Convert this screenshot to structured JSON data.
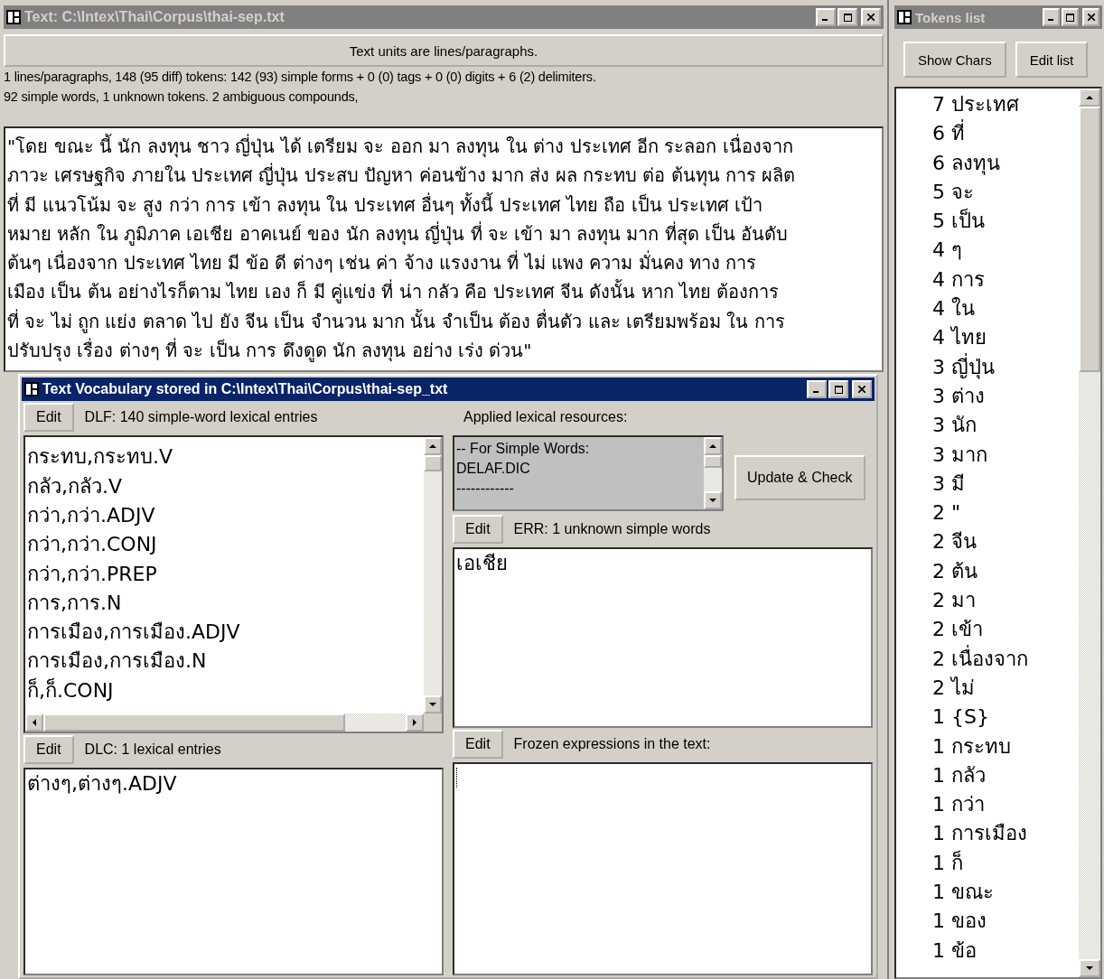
{
  "text_window": {
    "title": "Text: C:\\Intex\\Thai\\Corpus\\thai-sep.txt",
    "active": false,
    "units_button": "Text units are lines/paragraphs.",
    "stats": [
      "1 lines/paragraphs, 148 (95 diff) tokens: 142 (93) simple forms + 0 (0) tags + 0 (0) digits + 6 (2) delimiters.",
      "92 simple words, 1 unknown tokens. 2 ambiguous compounds,"
    ],
    "text_lines": [
      "\"โดย ขณะ นี้ นัก ลงทุน ชาว ญี่ปุ่น ได้ เตรียม จะ ออก มา ลงทุน ใน ต่าง ประเทศ อีก ระลอก เนื่องจาก",
      "ภาวะ เศรษฐกิจ ภายใน ประเทศ ญี่ปุ่น ประสบ ปัญหา ค่อนข้าง มาก ส่ง ผล กระทบ ต่อ ต้นทุน การ ผลิต",
      "ที่ มี แนวโน้ม จะ สูง กว่า การ เข้า ลงทุน ใน ประเทศ อื่นๆ ทั้งนี้ ประเทศ ไทย ถือ เป็น ประเทศ เป้า",
      "หมาย หลัก ใน ภูมิภาค เอเชีย อาคเนย์ ของ นัก ลงทุน ญี่ปุ่น ที่ จะ เข้า มา ลงทุน มาก ที่สุด เป็น อันดับ",
      "ต้นๆ เนื่องจาก ประเทศ ไทย มี ข้อ ดี ต่างๆ เช่น ค่า จ้าง แรงงาน ที่ ไม่ แพง ความ มั่นคง ทาง การ",
      "เมือง เป็น ต้น อย่างไรก็ตาม ไทย เอง ก็ มี คู่แข่ง ที่ น่า กลัว คือ ประเทศ จีน ดังนั้น หาก ไทย ต้องการ",
      "ที่ จะ ไม่ ถูก แย่ง ตลาด ไป ยัง จีน เป็น จำนวน มาก นั้น จำเป็น ต้อง ตื่นตัว และ เตรียมพร้อม ใน การ",
      "ปรับปรุง เรื่อง ต่างๆ ที่ จะ เป็น การ ดึงดูด นัก ลงทุน อย่าง เร่ง ด่วน\""
    ]
  },
  "vocabulary_window": {
    "title": "Text Vocabulary stored in C:\\Intex\\Thai\\Corpus\\thai-sep_txt",
    "active": true,
    "dlf": {
      "button": "Edit",
      "label": "DLF: 140 simple-word lexical entries",
      "entries": [
        "กระทบ,กระทบ.V",
        "กลัว,กลัว.V",
        "กว่า,กว่า.ADJV",
        "กว่า,กว่า.CONJ",
        "กว่า,กว่า.PREP",
        "การ,การ.N",
        "การเมือง,การเมือง.ADJV",
        "การเมือง,การเมือง.N",
        "ก็,ก็.CONJ"
      ]
    },
    "resources": {
      "label": "Applied lexical resources:",
      "lines": [
        "-- For Simple Words:",
        "DELAF.DIC",
        "------------"
      ],
      "button": "Update & Check"
    },
    "err": {
      "button": "Edit",
      "label": "ERR: 1 unknown simple words",
      "entries": [
        "เอเชีย"
      ]
    },
    "dlc": {
      "button": "Edit",
      "label": "DLC: 1 lexical entries",
      "entries": [
        "ต่างๆ,ต่างๆ.ADJV"
      ]
    },
    "frozen": {
      "button": "Edit",
      "label": "Frozen expressions in the text:"
    }
  },
  "tokens_window": {
    "title": "Tokens list",
    "active": false,
    "buttons": [
      "Show Chars",
      "Edit list"
    ],
    "tokens": [
      "7 ประเทศ",
      "6 ที่",
      "6 ลงทุน",
      "5 จะ",
      "5 เป็น",
      "4 ๆ",
      "4 การ",
      "4 ใน",
      "4 ไทย",
      "3 ญี่ปุ่น",
      "3 ต่าง",
      "3 นัก",
      "3 มาก",
      "3 มี",
      "2 \"",
      "2 จีน",
      "2 ต้น",
      "2 มา",
      "2 เข้า",
      "2 เนื่องจาก",
      "2 ไม่",
      "1 {S}",
      "1 กระทบ",
      "1 กลัว",
      "1 กว่า",
      "1 การเมือง",
      "1 ก็",
      "1 ขณะ",
      "1 ของ",
      "1 ข้อ"
    ]
  }
}
